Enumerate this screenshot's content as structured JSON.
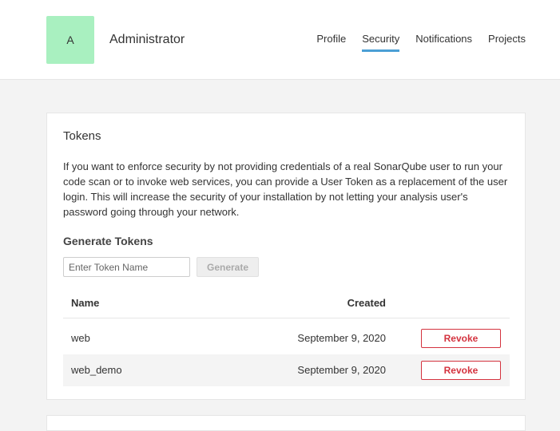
{
  "header": {
    "avatar_letter": "A",
    "user_name": "Administrator",
    "nav": [
      {
        "label": "Profile",
        "active": false
      },
      {
        "label": "Security",
        "active": true
      },
      {
        "label": "Notifications",
        "active": false
      },
      {
        "label": "Projects",
        "active": false
      }
    ],
    "accent_color": "#4b9fd5",
    "avatar_color": "#a9f0c0"
  },
  "tokens_panel": {
    "title": "Tokens",
    "description": "If you want to enforce security by not providing credentials of a real SonarQube user to run your code scan or to invoke web services, you can provide a User Token as a replacement of the user login. This will increase the security of your installation by not letting your analysis user's password going through your network.",
    "generate_title": "Generate Tokens",
    "input_placeholder": "Enter Token Name",
    "input_value": "",
    "generate_button": "Generate",
    "table": {
      "columns": {
        "name": "Name",
        "created": "Created"
      },
      "rows": [
        {
          "name": "web",
          "created": "September 9, 2020",
          "action": "Revoke"
        },
        {
          "name": "web_demo",
          "created": "September 9, 2020",
          "action": "Revoke"
        }
      ]
    },
    "revoke_color": "#d4333f"
  }
}
